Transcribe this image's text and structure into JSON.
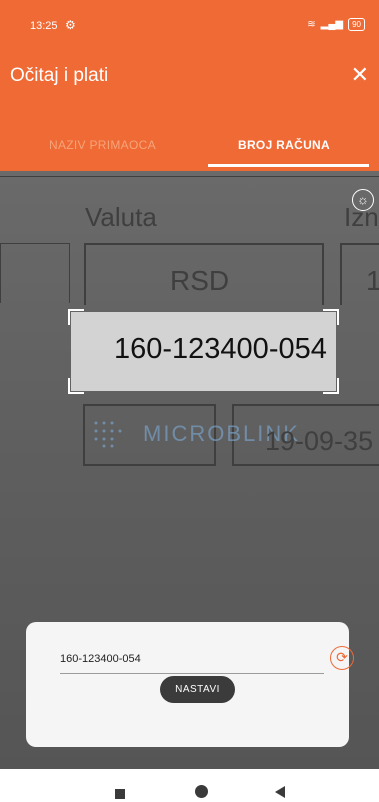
{
  "status_bar": {
    "time": "13:25",
    "battery": "90"
  },
  "app_bar": {
    "title": "Očitaj i plati",
    "close_icon": "close-icon"
  },
  "tabs": [
    {
      "label": "NAZIV PRIMAOCA",
      "active": false
    },
    {
      "label": "BROJ RAČUNA",
      "active": true
    }
  ],
  "camera": {
    "document_labels": {
      "valuta": "Valuta",
      "iznos_partial": "Izn",
      "currency": "RSD",
      "value_partial": "1",
      "date_partial": "19-09-35"
    },
    "scanned_text": "160-123400-054",
    "watermark": "MICROBLINK",
    "flash_icon": "brightness-icon"
  },
  "result_panel": {
    "account_value": "160-123400-054",
    "placeholder": "",
    "refresh_icon": "refresh-icon",
    "continue_label": "NASTAVI"
  },
  "colors": {
    "accent": "#ef6a35",
    "button_bg": "#3b3b3b"
  }
}
